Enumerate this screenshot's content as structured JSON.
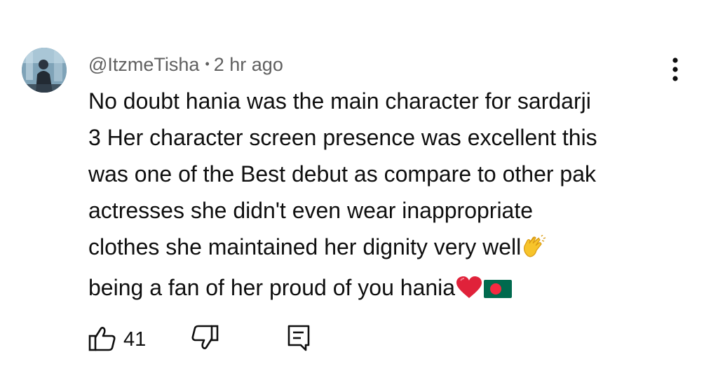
{
  "comment": {
    "author": "@ItzmeTisha",
    "separator": "•",
    "time": "2 hr ago",
    "lines": [
      "No doubt hania was the main character for sardarji",
      "3 Her character screen presence was excellent this",
      "was one of the Best debut as compare to other pak",
      "actresses she didn't even wear inappropriate",
      "clothes she maintained her dignity very well",
      "being a fan of her proud of you hania"
    ],
    "like_count": "41"
  },
  "icons": {
    "avatar": "avatar-photo",
    "menu": "more-vert-icon",
    "clap": "clapping-hands-emoji",
    "heart": "red-heart-emoji",
    "flag": "bangladesh-flag-emoji",
    "like": "thumbs-up-icon",
    "dislike": "thumbs-down-icon",
    "reply": "comment-reply-icon"
  },
  "colors": {
    "text": "#0f0f0f",
    "meta": "#606060",
    "heart": "#e0223a",
    "flag_green": "#006a4e",
    "flag_red": "#f42a41"
  }
}
